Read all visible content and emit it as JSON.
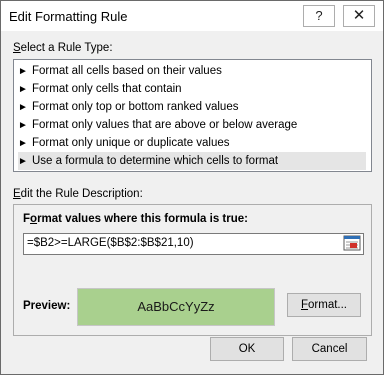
{
  "window": {
    "title": "Edit Formatting Rule",
    "help_glyph": "?",
    "close_glyph": "✕"
  },
  "rule_type": {
    "label_prefix": "",
    "label_underlined": "S",
    "label_rest": "elect a Rule Type:",
    "items": [
      {
        "label": "Format all cells based on their values",
        "selected": false
      },
      {
        "label": "Format only cells that contain",
        "selected": false
      },
      {
        "label": "Format only top or bottom ranked values",
        "selected": false
      },
      {
        "label": "Format only values that are above or below average",
        "selected": false
      },
      {
        "label": "Format only unique or duplicate values",
        "selected": false
      },
      {
        "label": "Use a formula to determine which cells to format",
        "selected": true
      }
    ],
    "item_arrow": "►"
  },
  "description": {
    "label_prefix": "",
    "label_underlined": "E",
    "label_rest": "dit the Rule Description:",
    "formula_label_prefix": "F",
    "formula_label_underlined": "o",
    "formula_label_rest": "rmat values where this formula is true:",
    "formula_value": "=$B2>=LARGE($B$2:$B$21,10)",
    "preview_label": "Preview:",
    "preview_sample": "AaBbCcYyZz",
    "preview_fill_color": "#a9d08e",
    "format_button_underlined": "F",
    "format_button_rest": "ormat..."
  },
  "footer": {
    "ok_label": "OK",
    "cancel_label": "Cancel"
  }
}
